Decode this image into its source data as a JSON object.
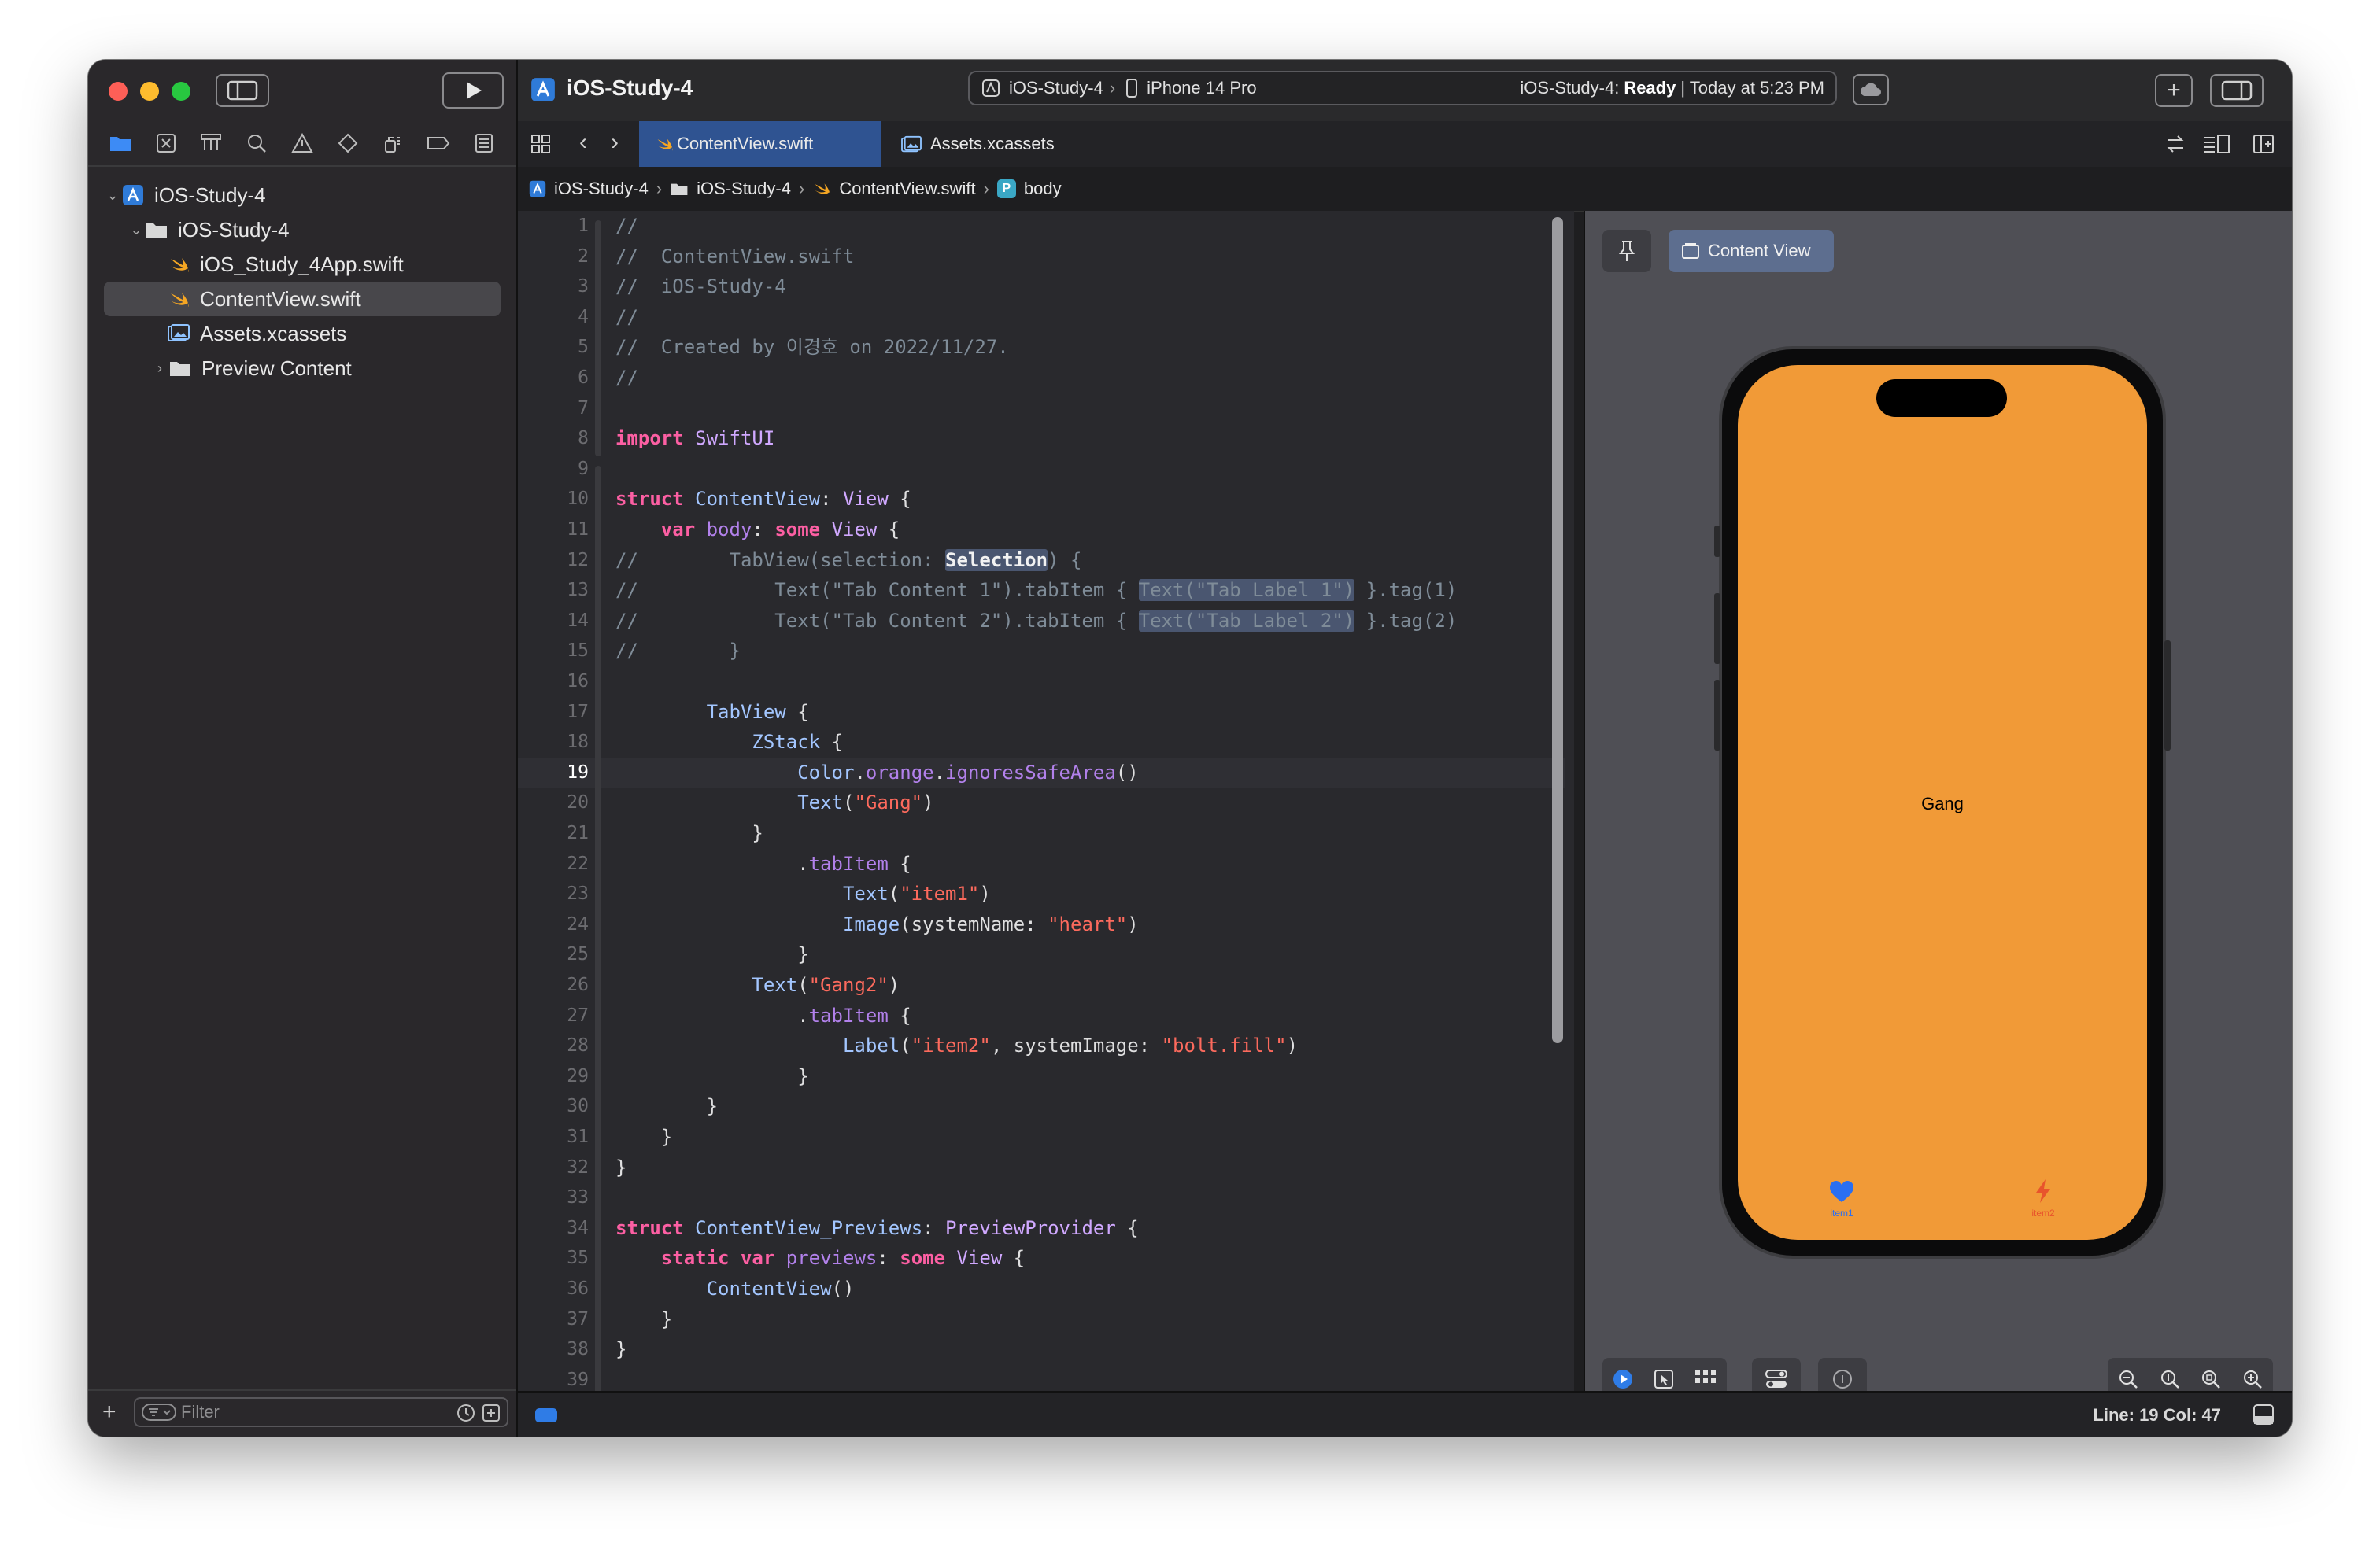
{
  "toolbar": {
    "project_title": "iOS-Study-4",
    "scheme": "iOS-Study-4",
    "device": "iPhone 14 Pro",
    "status_project": "iOS-Study-4:",
    "status_state": "Ready",
    "status_time": "| Today at 5:23 PM"
  },
  "tabs": [
    {
      "label": "ContentView.swift",
      "active": true
    },
    {
      "label": "Assets.xcassets",
      "active": false
    }
  ],
  "breadcrumb": [
    "iOS-Study-4",
    "iOS-Study-4",
    "ContentView.swift",
    "body"
  ],
  "navigator": {
    "items": [
      {
        "label": "iOS-Study-4",
        "kind": "project"
      },
      {
        "label": "iOS-Study-4",
        "kind": "folder"
      },
      {
        "label": "iOS_Study_4App.swift",
        "kind": "swift"
      },
      {
        "label": "ContentView.swift",
        "kind": "swift",
        "selected": true
      },
      {
        "label": "Assets.xcassets",
        "kind": "assets"
      },
      {
        "label": "Preview Content",
        "kind": "folder"
      }
    ],
    "filter_placeholder": "Filter"
  },
  "editor": {
    "current_line": 19,
    "line_numbers": [
      "1",
      "2",
      "3",
      "4",
      "5",
      "6",
      "7",
      "8",
      "9",
      "10",
      "11",
      "12",
      "13",
      "14",
      "15",
      "16",
      "17",
      "18",
      "19",
      "20",
      "21",
      "22",
      "23",
      "24",
      "25",
      "26",
      "27",
      "28",
      "29",
      "30",
      "31",
      "32",
      "33",
      "34",
      "35",
      "36",
      "37",
      "38",
      "39"
    ],
    "lines": [
      "//",
      "//  ContentView.swift",
      "//  iOS-Study-4",
      "//",
      "//  Created by 이경호 on 2022/11/27.",
      "//",
      "",
      "import SwiftUI",
      "",
      "struct ContentView: View {",
      "    var body: some View {",
      "//        TabView(selection: Selection) {",
      "//            Text(\"Tab Content 1\").tabItem { Text(\"Tab Label 1\") }.tag(1)",
      "//            Text(\"Tab Content 2\").tabItem { Text(\"Tab Label 2\") }.tag(2)",
      "//        }",
      "",
      "        TabView {",
      "            ZStack {",
      "                Color.orange.ignoresSafeArea()",
      "                Text(\"Gang\")",
      "            }",
      "                .tabItem {",
      "                    Text(\"item1\")",
      "                    Image(systemName: \"heart\")",
      "                }",
      "            Text(\"Gang2\")",
      "                .tabItem {",
      "                    Label(\"item2\", systemImage: \"bolt.fill\")",
      "                }",
      "        }",
      "    }",
      "}",
      "",
      "struct ContentView_Previews: PreviewProvider {",
      "    static var previews: some View {",
      "        ContentView()",
      "    }",
      "}",
      ""
    ]
  },
  "preview": {
    "selector_label": "Content View",
    "screen_text": "Gang",
    "tab_items": [
      {
        "label": "item1",
        "icon": "heart-icon",
        "color": "#2a6ff2"
      },
      {
        "label": "item2",
        "icon": "bolt-icon",
        "color": "#e8542c"
      }
    ],
    "background_color": "#f19a37"
  },
  "status_bar": {
    "cursor": "Line: 19  Col: 47"
  },
  "colors": {
    "accent": "#2f5391",
    "keyword": "#fc5fa3",
    "string": "#fc6a5d",
    "comment": "#7f8c98",
    "type": "#d0a8ff"
  }
}
